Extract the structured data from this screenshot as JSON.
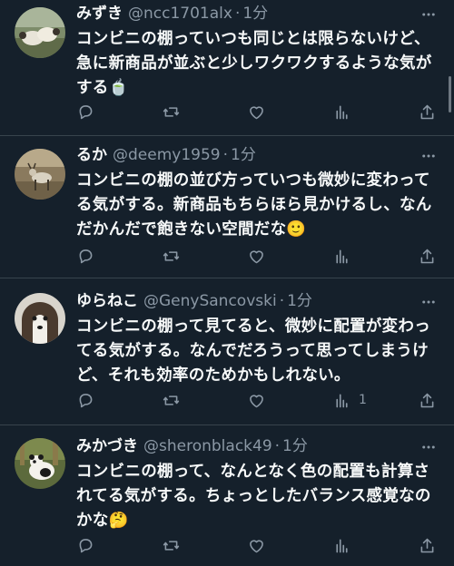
{
  "tweets": [
    {
      "name": "みずき",
      "handle": "@ncc1701alx",
      "dot": "·",
      "time": "1分",
      "text": "コンビニの棚っていつも同じとは限らないけど、急に新商品が並ぶと少しワクワクするような気がする",
      "emoji": "🍵",
      "views": "",
      "avatar_icon": "sheep-photo"
    },
    {
      "name": "るか",
      "handle": "@deemy1959",
      "dot": "·",
      "time": "1分",
      "text": "コンビニの棚の並び方っていつも微妙に変わってる気がする。新商品もちらほら見かけるし、なんだかんだで飽きない空間だな",
      "emoji": "🙂",
      "views": "",
      "avatar_icon": "deer-photo"
    },
    {
      "name": "ゆらねこ",
      "handle": "@GenySancovski",
      "dot": "·",
      "time": "1分",
      "text": "コンビニの棚って見てると、微妙に配置が変わってる気がする。なんでだろうって思ってしまうけど、それも効率のためかもしれない。",
      "emoji": "",
      "views": "1",
      "avatar_icon": "dog-photo"
    },
    {
      "name": "みかづき",
      "handle": "@sheronblack49",
      "dot": "·",
      "time": "1分",
      "text": "コンビニの棚って、なんとなく色の配置も計算されてる気がする。ちょっとしたバランス感覚なのかな",
      "emoji": "🤔",
      "views": "",
      "avatar_icon": "panda-photo"
    }
  ],
  "colors": {
    "background": "#15202b",
    "divider": "#38444d",
    "muted": "#8b98a5",
    "text": "#f7f9f9"
  },
  "icons": [
    "reply-icon",
    "retweet-icon",
    "like-icon",
    "views-icon",
    "share-icon",
    "more-icon"
  ]
}
